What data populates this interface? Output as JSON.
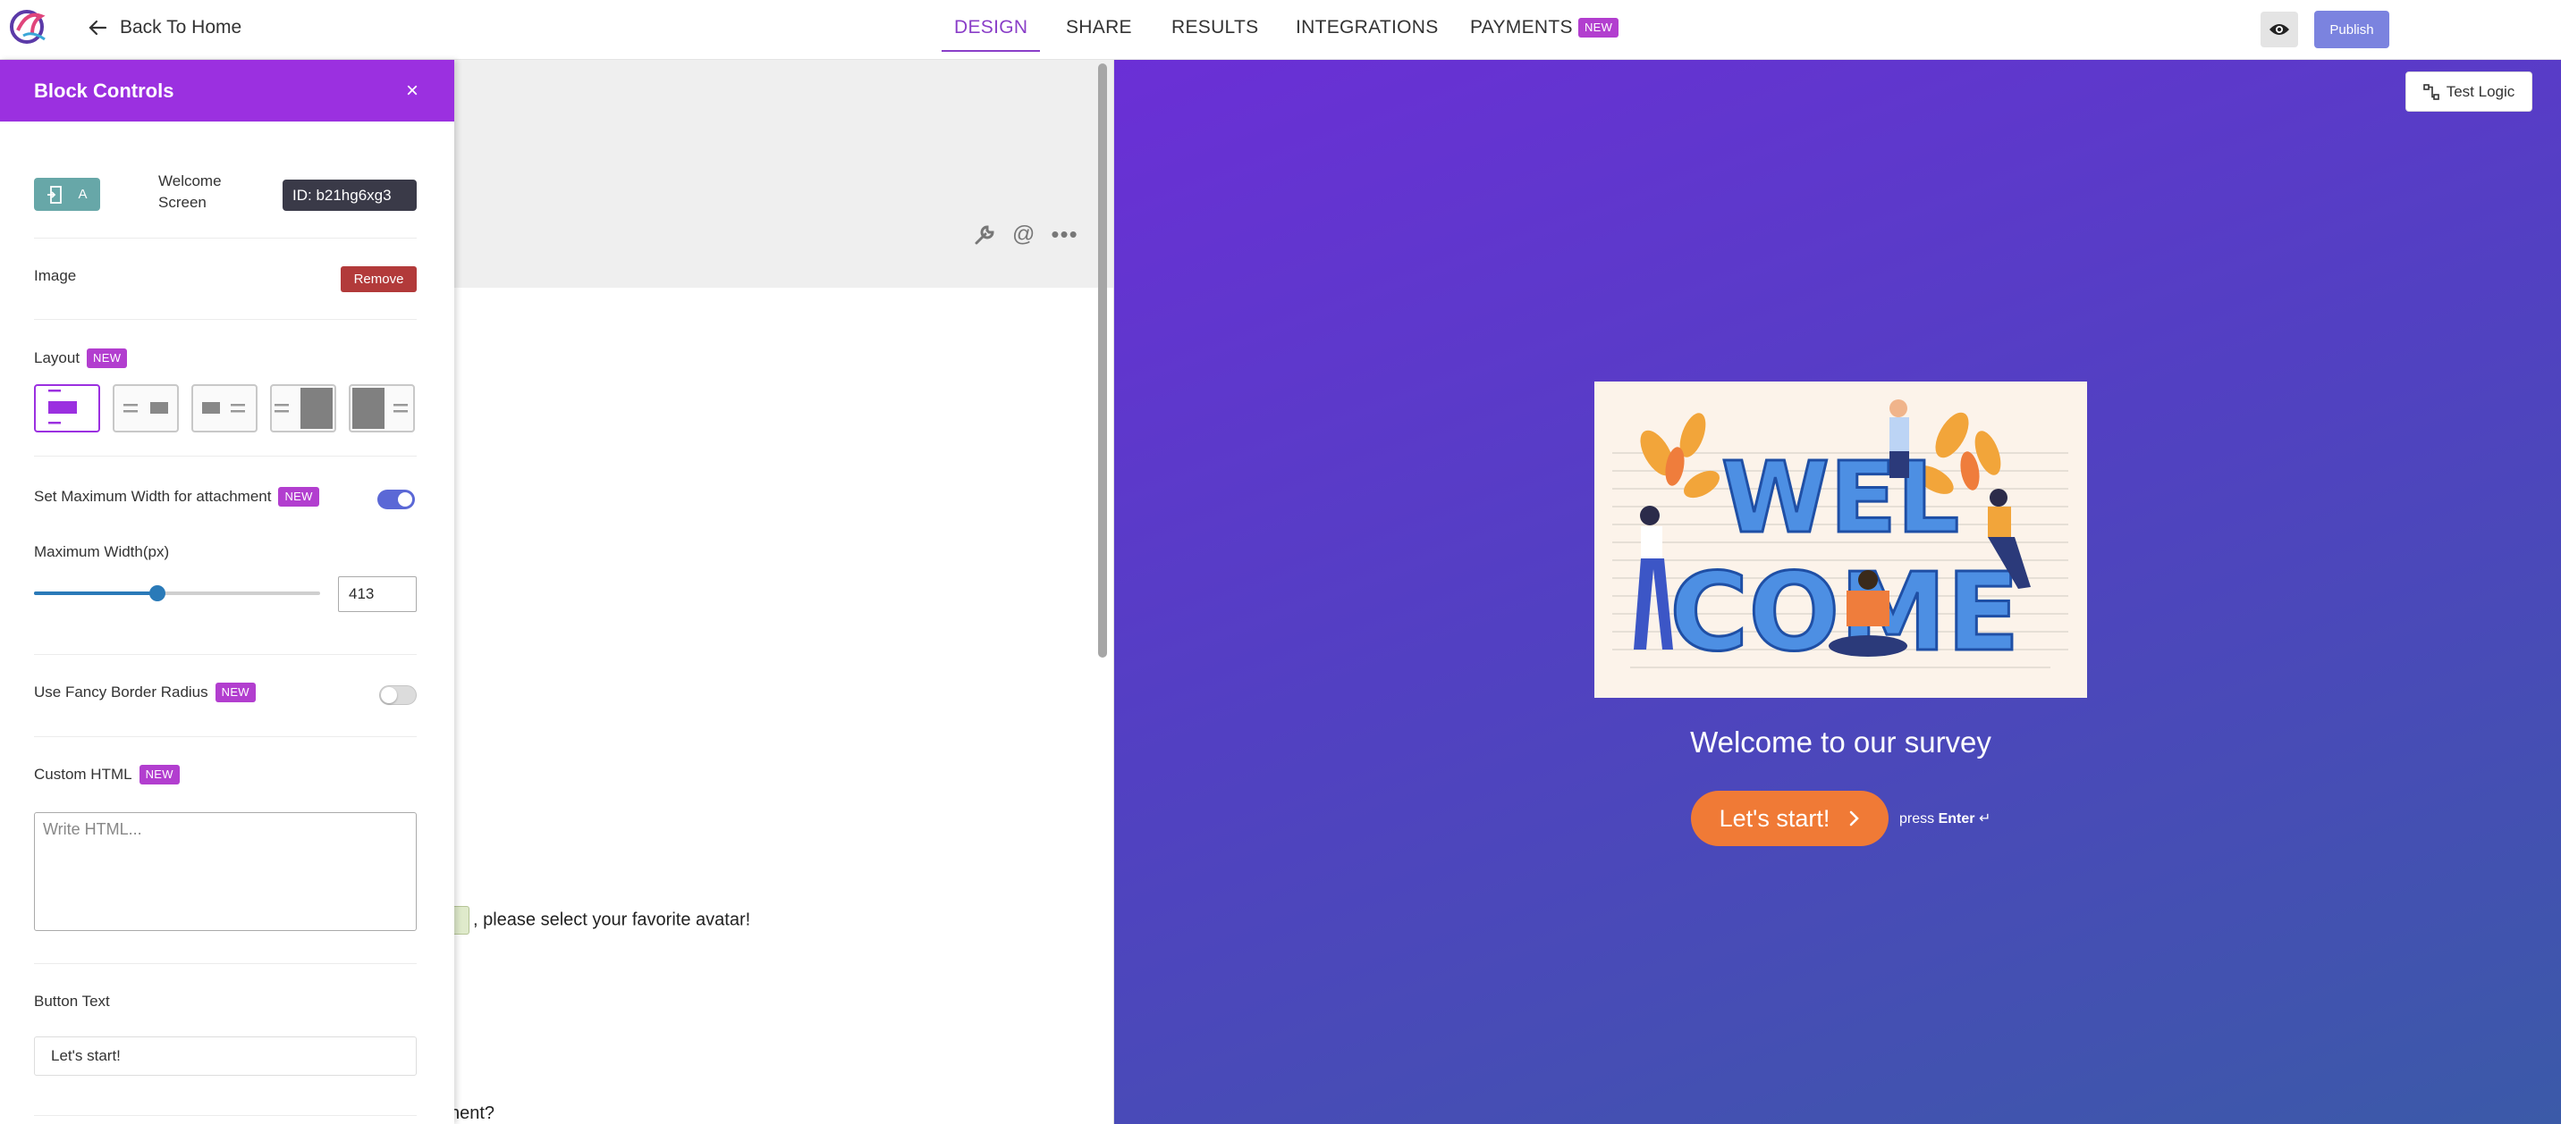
{
  "header": {
    "back_label": "Back To Home",
    "tabs": [
      {
        "label": "DESIGN",
        "active": true
      },
      {
        "label": "SHARE"
      },
      {
        "label": "RESULTS"
      },
      {
        "label": "INTEGRATIONS"
      },
      {
        "label": "PAYMENTS",
        "badge": "NEW"
      }
    ],
    "publish_label": "Publish",
    "preview_icon": "eye-icon"
  },
  "editor": {
    "line1_suffix": "!",
    "line2": ", please select your favorite avatar!",
    "line3": "nent?"
  },
  "panel": {
    "title": "Block Controls",
    "close_icon": "×",
    "block_icon_letter": "A",
    "block_type": "Welcome Screen",
    "block_id": "ID: b21hg6xg3",
    "image_label": "Image",
    "remove_label": "Remove",
    "layout_label": "Layout",
    "layout_badge": "NEW",
    "layout_selected": 0,
    "max_width_toggle_label": "Set Maximum Width for attachment",
    "max_width_toggle_badge": "NEW",
    "max_width_toggle_on": true,
    "max_width_label": "Maximum Width(px)",
    "max_width_value": "413",
    "max_width_slider_fraction": 0.43,
    "fancy_radius_label": "Use Fancy Border Radius",
    "fancy_radius_badge": "NEW",
    "fancy_radius_on": false,
    "custom_html_label": "Custom HTML",
    "custom_html_badge": "NEW",
    "custom_html_placeholder": "Write HTML...",
    "button_text_label": "Button Text",
    "button_text_value": "Let's start!"
  },
  "preview": {
    "test_logic_label": "Test Logic",
    "welcome_title": "Welcome to our survey",
    "start_button_label": "Let's start!",
    "press_prefix": "press",
    "press_key": "Enter",
    "press_symbol": "↵",
    "image_word_top": "WEL",
    "image_word_bottom": "COME"
  },
  "colors": {
    "accent_purple": "#9b30e0",
    "publish_blue": "#7b83df",
    "start_orange": "#f07a36",
    "remove_red": "#b23a3a"
  }
}
